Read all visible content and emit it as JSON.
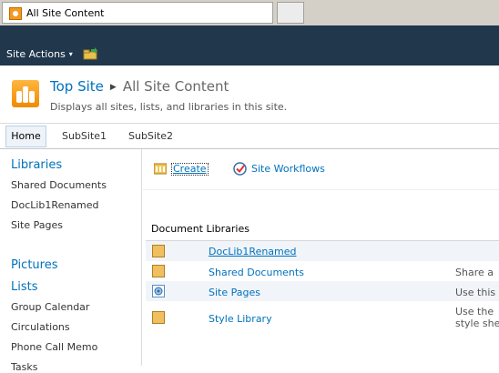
{
  "browser": {
    "tab_title": "All Site Content"
  },
  "ribbon": {
    "site_actions": "Site Actions",
    "site_actions_arrow": "▾"
  },
  "title_area": {
    "breadcrumb_root": "Top Site",
    "breadcrumb_sep": "▶",
    "breadcrumb_current": "All Site Content",
    "description": "Displays all sites, lists, and libraries in this site."
  },
  "top_nav": {
    "items": [
      "Home",
      "SubSite1",
      "SubSite2"
    ]
  },
  "left_nav": {
    "libraries_heading": "Libraries",
    "libraries": [
      "Shared Documents",
      "DocLib1Renamed",
      "Site Pages"
    ],
    "pictures_heading": "Pictures",
    "lists_heading": "Lists",
    "lists": [
      "Group Calendar",
      "Circulations",
      "Phone Call Memo",
      "Tasks"
    ]
  },
  "toolbar": {
    "create_label": "Create",
    "site_workflows_label": "Site Workflows"
  },
  "main": {
    "section_heading": "Document Libraries",
    "rows": [
      {
        "name": "DocLib1Renamed",
        "desc1": "",
        "desc2": ""
      },
      {
        "name": "Shared Documents",
        "desc1": "Share a",
        "desc2": ""
      },
      {
        "name": "Site Pages",
        "desc1": "Use this",
        "desc2": ""
      },
      {
        "name": "Style Library",
        "desc1": "Use the",
        "desc2": "style she"
      }
    ]
  },
  "colors": {
    "ribbon_bg": "#21374c",
    "link_blue": "#0072bc",
    "alt_row_bg": "#f1f5f9"
  },
  "icons": [
    "sharepoint-icon",
    "navigate-up-icon",
    "site-logo-icon",
    "create-icon",
    "workflow-icon",
    "document-library-icon",
    "wiki-library-icon"
  ]
}
